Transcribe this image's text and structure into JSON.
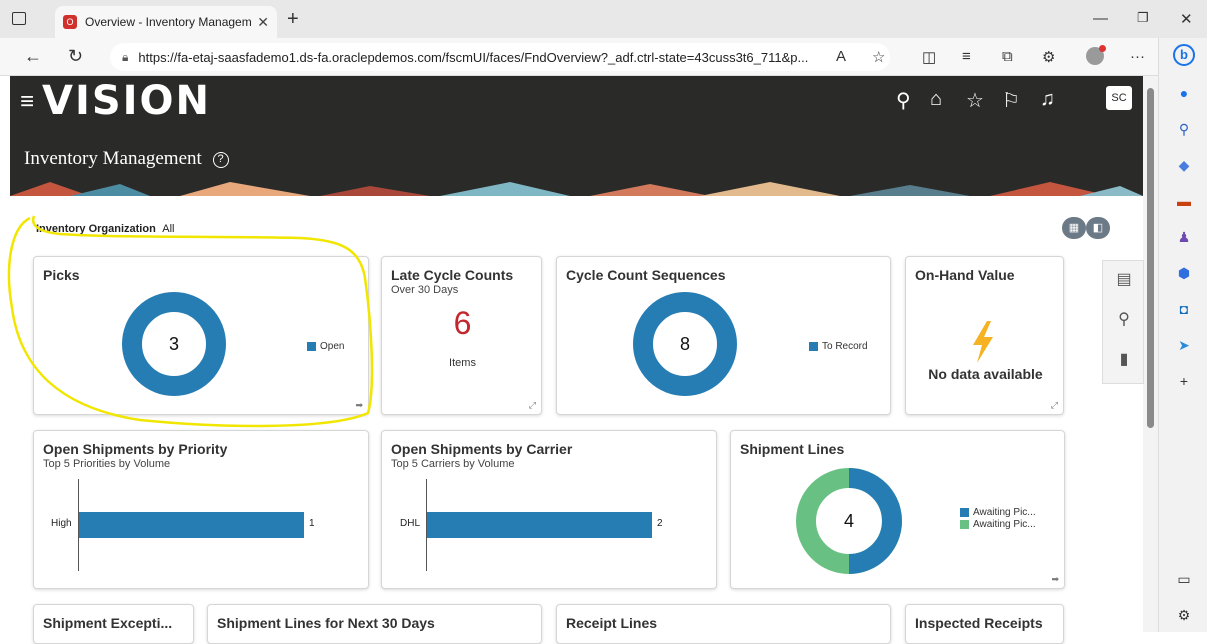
{
  "browser": {
    "tab_title": "Overview - Inventory Manageme",
    "url": "https://fa-etaj-saasfademo1.ds-fa.oraclepdemos.com/fscmUI/faces/FndOverview?_adf.ctrl-state=43cuss3t6_711&p..."
  },
  "app": {
    "logo": "VISION",
    "title": "Inventory Management",
    "user_initials": "SC"
  },
  "filter": {
    "label": "Inventory Organization",
    "value": "All"
  },
  "cards": {
    "picks": {
      "title": "Picks",
      "value": "3",
      "legend": "Open"
    },
    "late_cycle": {
      "title": "Late Cycle Counts",
      "subtitle": "Over 30 Days",
      "value": "6",
      "unit": "Items"
    },
    "cycle_seq": {
      "title": "Cycle Count Sequences",
      "value": "8",
      "legend": "To Record"
    },
    "onhand": {
      "title": "On-Hand Value",
      "message": "No data available"
    },
    "ship_priority": {
      "title": "Open Shipments by Priority",
      "subtitle": "Top 5 Priorities by Volume",
      "category": "High",
      "value": "1"
    },
    "ship_carrier": {
      "title": "Open Shipments by Carrier",
      "subtitle": "Top 5 Carriers by Volume",
      "category": "DHL",
      "value": "2"
    },
    "ship_lines": {
      "title": "Shipment Lines",
      "value": "4",
      "legend1": "Awaiting Pic...",
      "legend2": "Awaiting Pic..."
    },
    "ship_exceptions": {
      "title": "Shipment Excepti..."
    },
    "ship_next30": {
      "title": "Shipment Lines for Next 30 Days"
    },
    "receipt_lines": {
      "title": "Receipt Lines"
    },
    "inspected": {
      "title": "Inspected Receipts"
    }
  },
  "colors": {
    "primary": "#267db3",
    "secondary": "#68c182",
    "late_value": "#c1272d",
    "lightning": "#f5b323",
    "header_bg": "#2a2a29",
    "highlight": "#f0e600"
  },
  "icons": [
    "search-icon",
    "home-icon",
    "star-icon",
    "flag-icon",
    "bell-icon",
    "help-icon",
    "lightning-icon",
    "expand-icon",
    "detail-icon",
    "magnify-icon",
    "bar-chart-icon"
  ]
}
